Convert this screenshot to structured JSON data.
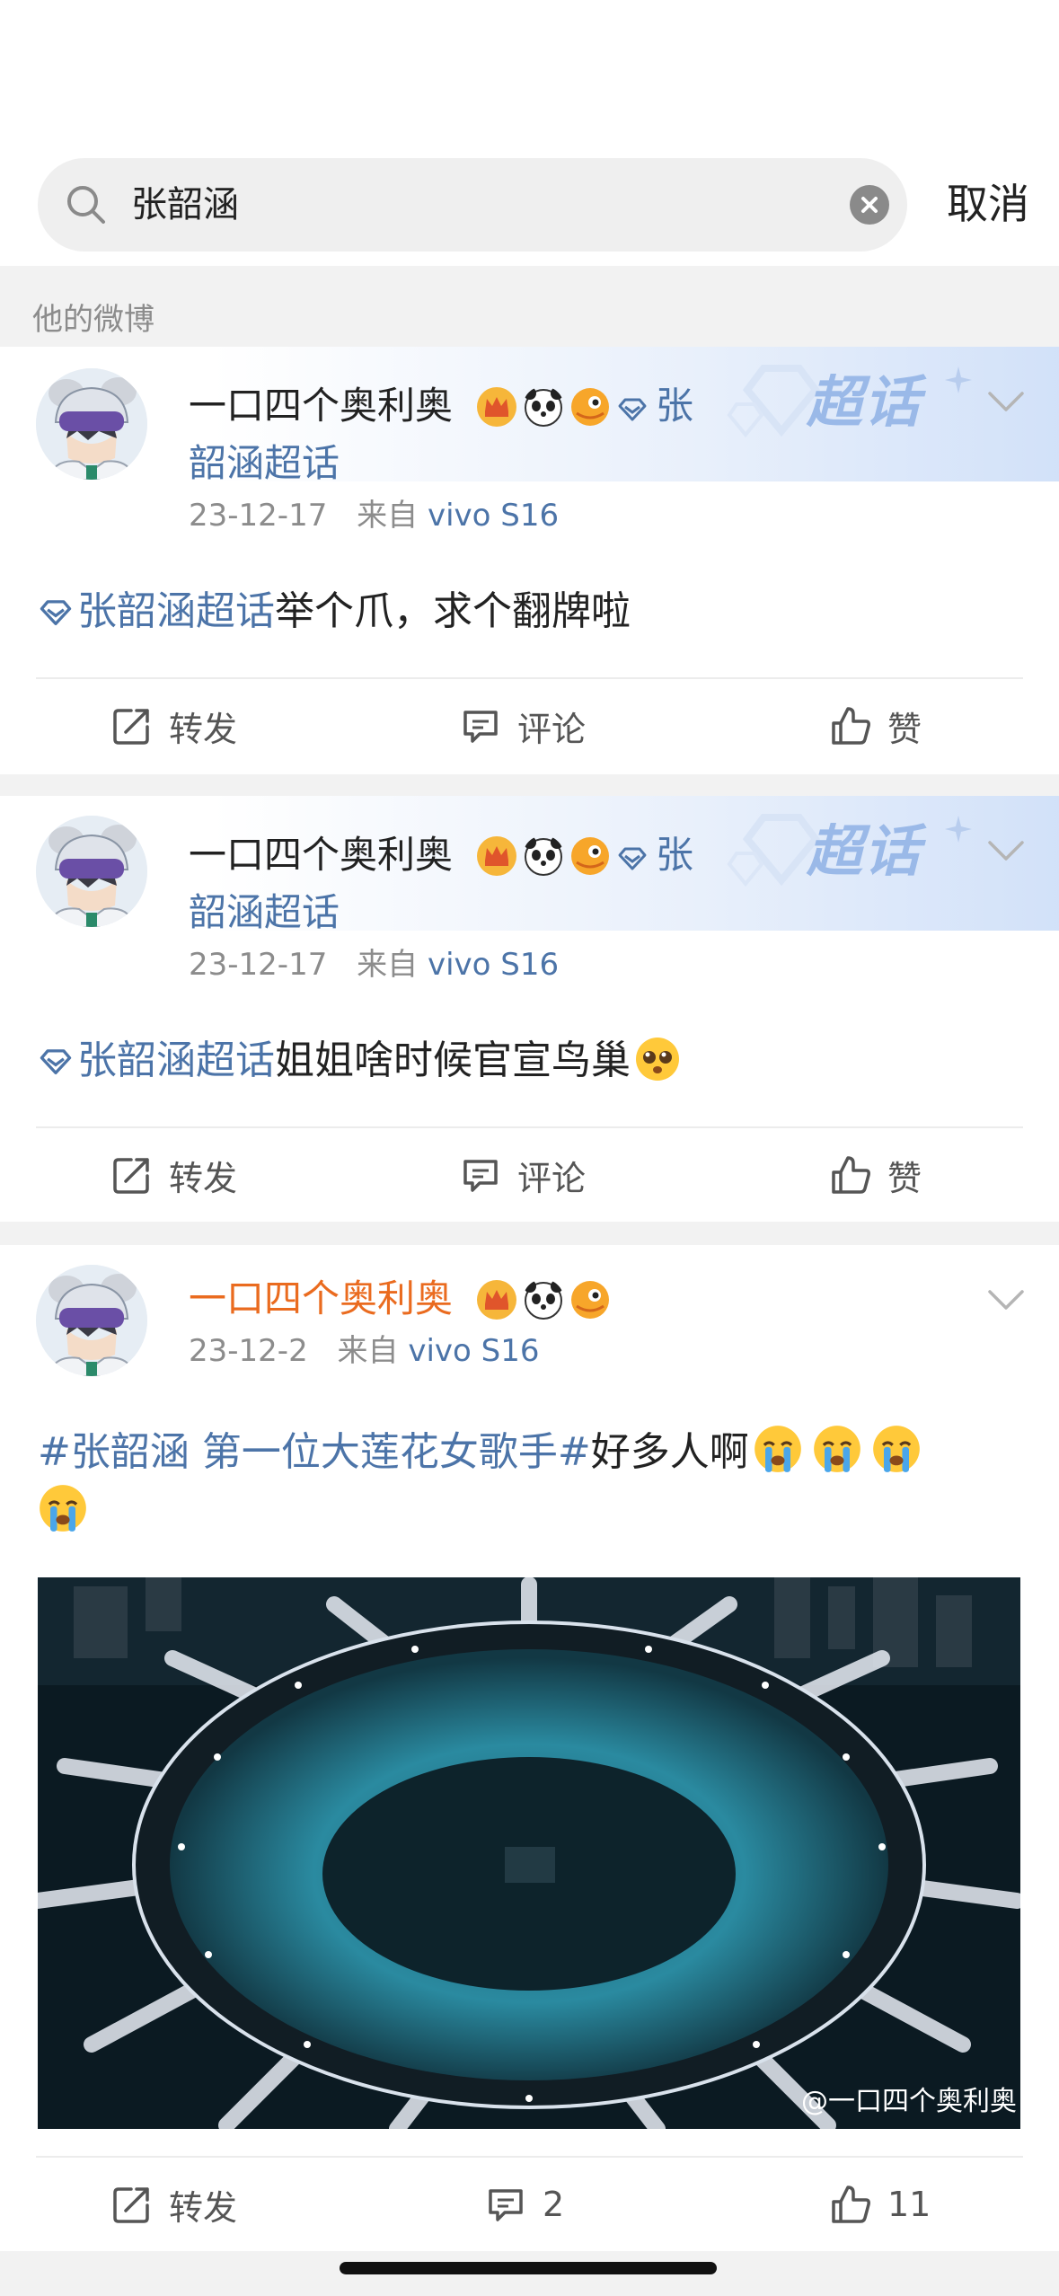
{
  "search": {
    "query": "张韶涵",
    "cancel_label": "取消"
  },
  "section_label": "他的微博",
  "banner_text": "超话",
  "posts": [
    {
      "author": "一口四个奥利奥",
      "topic_name": "张韶涵超话",
      "topic_part1": "张",
      "topic_part2": "韶涵超话",
      "date": "23-12-17",
      "source_prefix": "来自",
      "source": "vivo S16",
      "body_topic": "张韶涵超话",
      "body_text": "举个爪，求个翻牌啦",
      "repost_label": "转发",
      "comment_label": "评论",
      "like_label": "赞"
    },
    {
      "author": "一口四个奥利奥",
      "topic_part1": "张",
      "topic_part2": "韶涵超话",
      "date": "23-12-17",
      "source_prefix": "来自",
      "source": "vivo S16",
      "body_topic": "张韶涵超话",
      "body_text": "姐姐啥时候官宣鸟巢",
      "repost_label": "转发",
      "comment_label": "评论",
      "like_label": "赞"
    },
    {
      "author": "一口四个奥利奥",
      "date": "23-12-2",
      "source_prefix": "来自",
      "source": "vivo S16",
      "body_hashtag": "#张韶涵 第一位大莲花女歌手#",
      "body_text": "好多人啊",
      "photo_watermark": "@一口四个奥利奥",
      "repost_label": "转发",
      "comment_count": "2",
      "like_count": "11"
    }
  ],
  "icons": {
    "search": "magnifier-icon",
    "clear": "clear-x-icon",
    "chevron": "chevron-down-icon",
    "diamond": "supertopic-diamond-icon",
    "repost": "repost-icon",
    "comment": "comment-icon",
    "like": "thumbs-up-icon"
  },
  "colors": {
    "link": "#4c74a8",
    "author_highlight": "#ea6b1f",
    "banner": "#9ab9e8",
    "meta": "#8c8c8c"
  }
}
